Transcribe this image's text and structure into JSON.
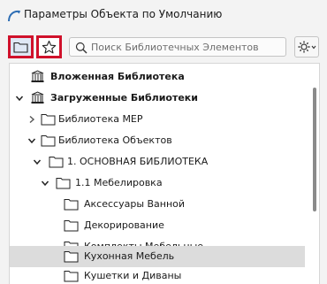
{
  "window": {
    "title": "Параметры Объекта по Умолчанию"
  },
  "toolbar": {
    "search_placeholder": "Поиск Библиотечных Элементов",
    "folder_button_icon": "folder-icon",
    "favorites_button_icon": "star-icon",
    "settings_icon": "gear-icon",
    "highlight_color": "#d0112b"
  },
  "tree": {
    "items": [
      {
        "label": "Вложенная Библиотека",
        "bold": true,
        "icon": "library-icon",
        "expander": "none",
        "depth": 0
      },
      {
        "label": "Загруженные Библиотеки",
        "bold": true,
        "icon": "library-icon",
        "expander": "expanded",
        "depth": 0
      },
      {
        "label": "Библиотека MEP",
        "bold": false,
        "icon": "folder-icon",
        "expander": "collapsed",
        "depth": 1
      },
      {
        "label": "Библиотека Объектов",
        "bold": false,
        "icon": "folder-icon",
        "expander": "expanded",
        "depth": 1
      },
      {
        "label": "1. ОСНОВНАЯ БИБЛИОТЕКА",
        "bold": false,
        "icon": "folder-icon",
        "expander": "expanded",
        "depth": 2
      },
      {
        "label": "1.1 Мебелировка",
        "bold": false,
        "icon": "folder-icon",
        "expander": "expanded",
        "depth": 3
      },
      {
        "label": "Аксессуары Ванной",
        "bold": false,
        "icon": "folder-icon",
        "expander": "none",
        "depth": 4
      },
      {
        "label": "Декорирование",
        "bold": false,
        "icon": "folder-icon",
        "expander": "none",
        "depth": 4
      },
      {
        "label": "Комплекты Мебельные",
        "bold": false,
        "icon": "folder-icon",
        "expander": "none",
        "depth": 4
      },
      {
        "label": "Кухонная Мебель",
        "bold": false,
        "icon": "folder-icon",
        "expander": "none",
        "depth": 4,
        "selected": true
      },
      {
        "label": "Кушетки и Диваны",
        "bold": false,
        "icon": "folder-icon",
        "expander": "none",
        "depth": 4
      }
    ]
  }
}
